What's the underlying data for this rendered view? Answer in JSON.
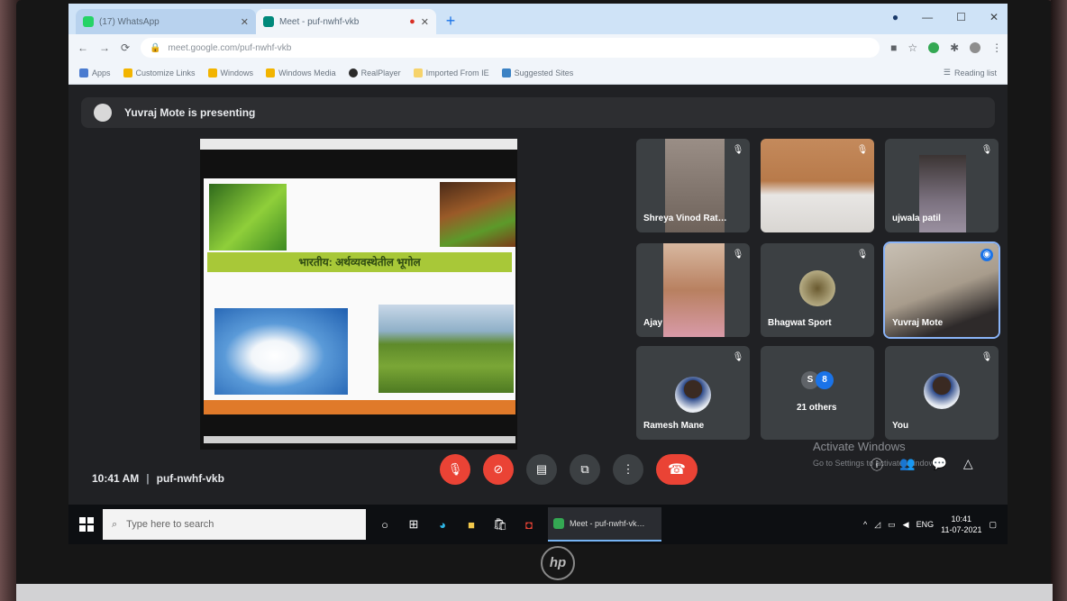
{
  "browser": {
    "tabs": [
      {
        "title": "(17) WhatsApp",
        "active": false,
        "favicon_color": "#25d366"
      },
      {
        "title": "Meet - puf-nwhf-vkb",
        "active": true,
        "favicon_color": "#00897b"
      }
    ],
    "new_tab": "+",
    "url": "meet.google.com/puf-nwhf-vkb",
    "bookmarks": [
      {
        "label": "Apps",
        "color": "#4a7bd0"
      },
      {
        "label": "Customize Links",
        "color": "#f2b400"
      },
      {
        "label": "Windows",
        "color": "#f2b400"
      },
      {
        "label": "Windows Media",
        "color": "#f2b400"
      },
      {
        "label": "RealPlayer",
        "color": "#2a2a2a"
      },
      {
        "label": "Imported From IE",
        "color": "#f6d36b"
      },
      {
        "label": "Suggested Sites",
        "color": "#3b82c4"
      }
    ],
    "reading_list": "Reading list"
  },
  "meet": {
    "presenting_banner": "Yuvraj Mote is presenting",
    "slide": {
      "banner_text": "भारतीय: अर्थव्यवस्थेतील भूगोल",
      "accent": "#a8c838",
      "footer_color": "#e07a2a"
    },
    "participants": [
      {
        "name": "Shreya Vinod Rat…",
        "has_video": true
      },
      {
        "name": "",
        "has_video": true
      },
      {
        "name": "ujwala patil",
        "has_video": true
      },
      {
        "name": "Ajay",
        "has_video": true
      },
      {
        "name": "Bhagwat Sport",
        "has_video": false
      },
      {
        "name": "Yuvraj Mote",
        "has_video": true,
        "speaking": true
      },
      {
        "name": "Ramesh Mane",
        "has_video": false
      },
      {
        "name": "21 others",
        "has_video": false,
        "badges": [
          "S",
          "8"
        ]
      },
      {
        "name": "You",
        "has_video": false
      }
    ],
    "time": "10:41 AM",
    "separator": "|",
    "meeting_code": "puf-nwhf-vkb",
    "watermark_title": "Activate Windows",
    "watermark_sub": "Go to Settings to activate Windows."
  },
  "taskbar": {
    "search_placeholder": "Type here to search",
    "active_app": "Meet - puf-nwhf-vk…",
    "lang": "ENG",
    "clock_time": "10:41",
    "clock_date": "11-07-2021"
  },
  "brand": "hp"
}
